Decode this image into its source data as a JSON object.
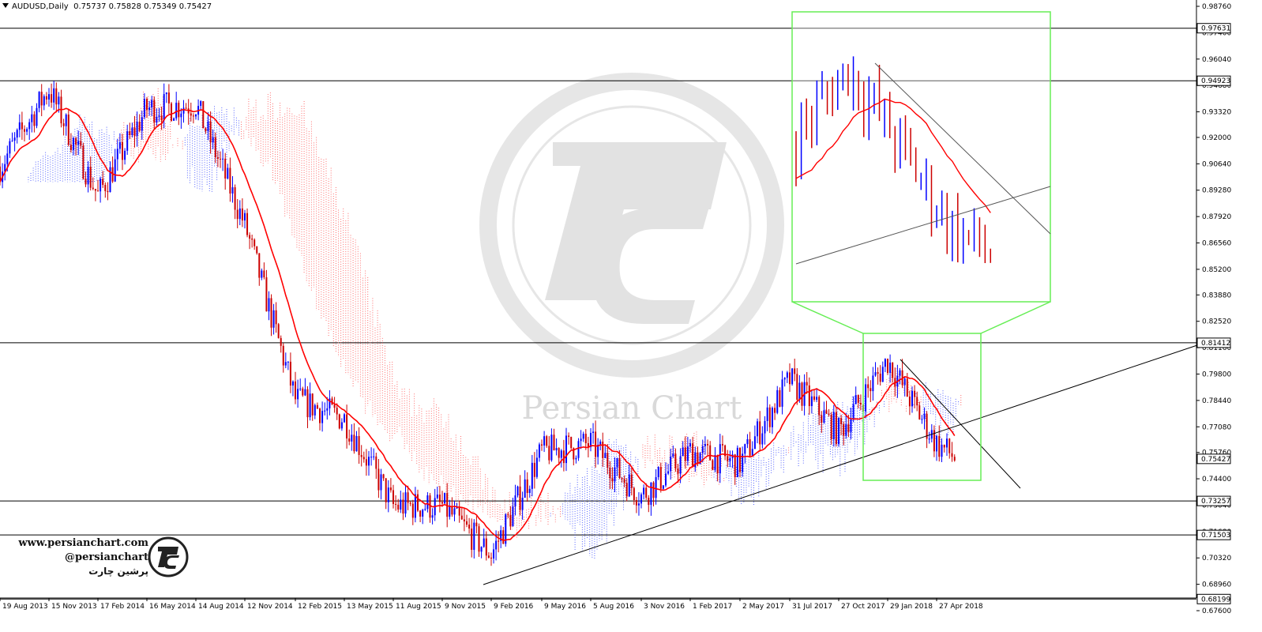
{
  "header": {
    "symbol_timeframe": "AUDUSD,Daily",
    "open": "0.75737",
    "high": "0.75828",
    "low": "0.75349",
    "close": "0.75427"
  },
  "price_axis": {
    "ticks": [
      "0.98760",
      "0.97400",
      "0.96040",
      "0.94680",
      "0.93320",
      "0.92000",
      "0.90640",
      "0.89280",
      "0.87920",
      "0.86560",
      "0.85200",
      "0.83880",
      "0.82520",
      "0.81160",
      "0.79800",
      "0.78440",
      "0.77080",
      "0.75760",
      "0.74400",
      "0.73040",
      "0.71680",
      "0.70320",
      "0.68960",
      "0.67600"
    ],
    "level_labels": [
      "0.97631",
      "0.94923",
      "0.81412",
      "0.75427",
      "0.73257",
      "0.71503",
      "0.68199"
    ],
    "current_price_label": "0.75427"
  },
  "time_axis": {
    "labels": [
      "19 Aug 2013",
      "15 Nov 2013",
      "17 Feb 2014",
      "16 May 2014",
      "14 Aug 2014",
      "12 Nov 2014",
      "12 Feb 2015",
      "13 May 2015",
      "11 Aug 2015",
      "9 Nov 2015",
      "9 Feb 2016",
      "9 May 2016",
      "5 Aug 2016",
      "3 Nov 2016",
      "1 Feb 2017",
      "2 May 2017",
      "31 Jul 2017",
      "27 Oct 2017",
      "29 Jan 2018",
      "27 Apr 2018"
    ]
  },
  "watermark": {
    "initials": "PC",
    "text": "Persian Chart"
  },
  "branding": {
    "website": "www.persianchart.com",
    "handle": "@persianchart",
    "name_fa": "پرشین چارت"
  },
  "colors": {
    "bull_candle": "#0000ff",
    "bear_candle": "#cc0000",
    "moving_average": "#ff0000",
    "cloud_bull": "#2a3cff",
    "cloud_bear": "#ff4a4a",
    "zoom_box": "#66ee55",
    "level_line": "#000000",
    "trend_line": "#000000"
  },
  "chart_data": {
    "type": "line",
    "title": "",
    "symbol": "AUDUSD",
    "timeframe": "Daily",
    "x_labels": [
      "19 Aug 2013",
      "15 Nov 2013",
      "17 Feb 2014",
      "16 May 2014",
      "14 Aug 2014",
      "12 Nov 2014",
      "12 Feb 2015",
      "13 May 2015",
      "11 Aug 2015",
      "9 Nov 2015",
      "9 Feb 2016",
      "9 May 2016",
      "5 Aug 2016",
      "3 Nov 2016",
      "1 Feb 2017",
      "2 May 2017",
      "31 Jul 2017",
      "27 Oct 2017",
      "29 Jan 2018",
      "27 Apr 2018"
    ],
    "series": [
      {
        "values": [
          0.905,
          0.945,
          0.89,
          0.935,
          0.937,
          0.875,
          0.785,
          0.775,
          0.73,
          0.73,
          0.705,
          0.758,
          0.762,
          0.735,
          0.758,
          0.752,
          0.795,
          0.768,
          0.805,
          0.762
        ]
      }
    ],
    "horizontal_levels": [
      0.97631,
      0.94923,
      0.81412,
      0.73257,
      0.71503,
      0.68199
    ],
    "ylim": [
      0.676,
      0.9876
    ],
    "grid": false,
    "legend": "none"
  }
}
